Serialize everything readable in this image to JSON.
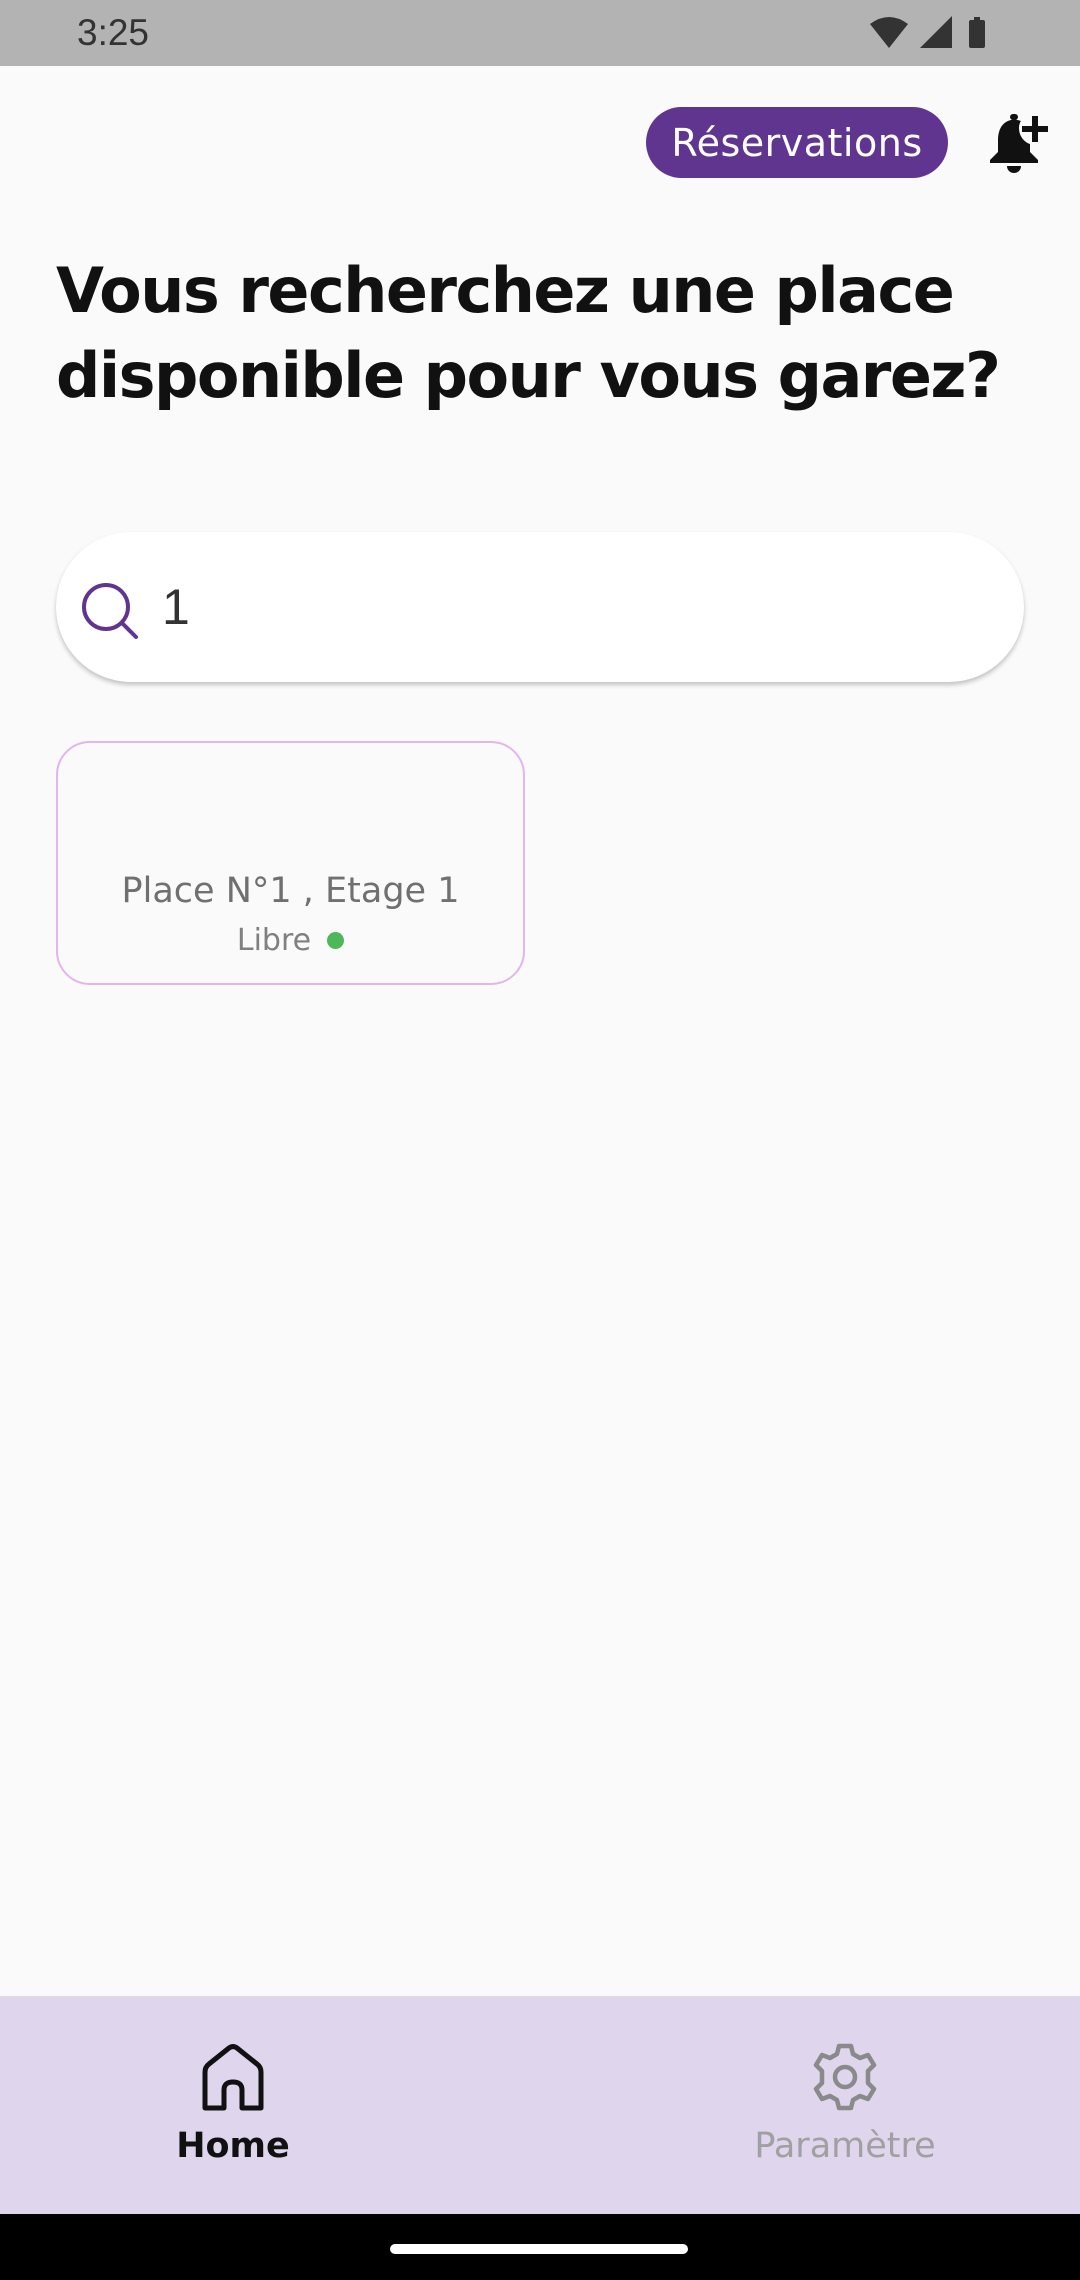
{
  "status_bar": {
    "time": "3:25",
    "icons": [
      "wifi-icon",
      "cell-signal-icon",
      "battery-icon"
    ]
  },
  "header": {
    "reservations_label": "Réservations",
    "bell_icon": "bell-plus-icon"
  },
  "main": {
    "title": "Vous recherchez une place disponible pour vous garez?",
    "search": {
      "value": "1",
      "icon": "search-icon"
    },
    "places": [
      {
        "label": "Place N°1 , Etage 1",
        "status": "Libre",
        "status_color": "#4db85a"
      }
    ]
  },
  "bottom_nav": {
    "items": [
      {
        "label": "Home",
        "icon": "home-icon",
        "active": true
      },
      {
        "label": "Paramètre",
        "icon": "gear-icon",
        "active": false
      }
    ]
  },
  "colors": {
    "accent": "#5f3590",
    "nav_background": "#dfd5ec",
    "card_border": "#e3b5ee",
    "status_free": "#4db85a"
  }
}
